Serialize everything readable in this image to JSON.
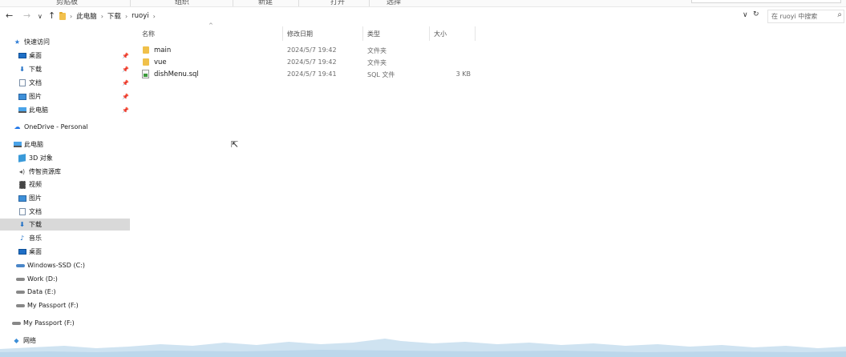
{
  "ribbon": {
    "groups": [
      "剪贴板",
      "组织",
      "新建",
      "打开",
      "选择"
    ]
  },
  "address": {
    "back_icon": "←",
    "forward_icon": "→",
    "recent_icon": "∨",
    "up_icon": "↑",
    "breadcrumbs": [
      "此电脑",
      "下载",
      "ruoyi"
    ],
    "refresh_icon": "↻",
    "dropdown_icon": "∨",
    "search_placeholder": "在 ruoyi 中搜索",
    "search_icon": "⌕"
  },
  "sidebar": {
    "quick_access": "快速访问",
    "quick_items": [
      "桌面",
      "下载",
      "文档",
      "图片",
      "此电脑"
    ],
    "onedrive": "OneDrive - Personal",
    "this_pc": "此电脑",
    "pc_items": [
      "3D 对象",
      "传智资源库",
      "视频",
      "图片",
      "文档",
      "下载",
      "音乐",
      "桌面",
      "Windows-SSD (C:)",
      "Work (D:)",
      "Data (E:)",
      "My Passport (F:)"
    ],
    "passport": "My Passport (F:)",
    "network": "网络",
    "selected": "下载"
  },
  "columns": {
    "name": "名称",
    "date": "修改日期",
    "type": "类型",
    "size": "大小"
  },
  "files": [
    {
      "name": "main",
      "date": "2024/5/7 19:42",
      "type": "文件夹",
      "size": "",
      "kind": "folder"
    },
    {
      "name": "vue",
      "date": "2024/5/7 19:42",
      "type": "文件夹",
      "size": "",
      "kind": "folder"
    },
    {
      "name": "dishMenu.sql",
      "date": "2024/5/7 19:41",
      "type": "SQL 文件",
      "size": "3 KB",
      "kind": "sql"
    }
  ]
}
